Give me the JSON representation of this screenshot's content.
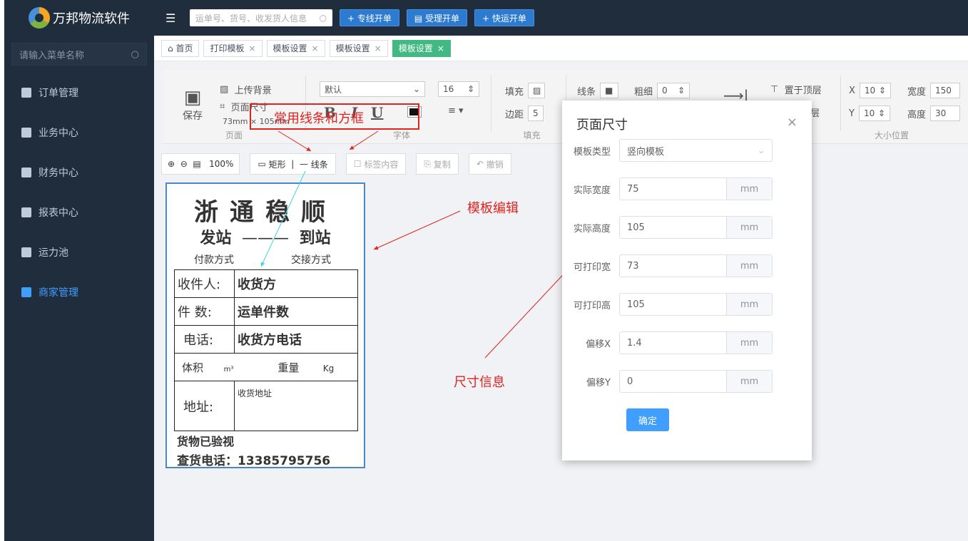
{
  "app": {
    "title": "万邦物流软件"
  },
  "top": {
    "search_placeholder": "运单号、货号、收发货人信息",
    "buttons": [
      "+ 专线开单",
      "▤ 受理开单",
      "+ 快运开单"
    ]
  },
  "sidebar": {
    "search_placeholder": "请输入菜单名称",
    "items": [
      "订单管理",
      "业务中心",
      "财务中心",
      "报表中心",
      "运力池",
      "商家管理"
    ]
  },
  "tabs": [
    {
      "label": "首页"
    },
    {
      "label": "打印模板"
    },
    {
      "label": "模板设置"
    },
    {
      "label": "模板设置"
    },
    {
      "label": "模板设置"
    }
  ],
  "toolbar": {
    "page": {
      "save": "保存",
      "upload": "上传背景",
      "size": "页面尺寸",
      "size_value": "73mm × 105mm",
      "label": "页面"
    },
    "font": {
      "family": "默认",
      "size": "16",
      "bold": "B",
      "italic": "I",
      "underline": "U",
      "label": "字体"
    },
    "fill": {
      "fill": "填充",
      "margin": "边距",
      "margin_value": "5",
      "label": "填充"
    },
    "line": {
      "line": "线条",
      "thick": "粗细",
      "thick_value": "0"
    },
    "layer": {
      "top": "置于顶层",
      "bottom": "层"
    },
    "pos": {
      "x_label": "X",
      "x": "10",
      "y_label": "Y",
      "y": "10",
      "w_label": "宽度",
      "w": "150",
      "h_label": "高度",
      "h": "30",
      "label": "大小位置"
    }
  },
  "tools2": {
    "zoom": "100%",
    "rect": "矩形",
    "line": "线条",
    "label_content": "标签内容",
    "copy": "复制",
    "undo": "撤销"
  },
  "label": {
    "title": "浙通稳顺",
    "from": "发站",
    "to": "到站",
    "pay": "付款方式",
    "handover": "交接方式",
    "rows": [
      {
        "k": "收件人:",
        "v": "收货方"
      },
      {
        "k": "件 数:",
        "v": "运单件数"
      },
      {
        "k": "电话:",
        "v": "收货方电话"
      }
    ],
    "volume": "体积",
    "volume_unit": "m³",
    "weight": "重量",
    "weight_unit": "Kg",
    "address": "地址:",
    "address_value": "收货地址",
    "footer1": "货物已验视",
    "footer2": "查货电话：13385795756"
  },
  "annotations": {
    "lines": "常用线条和方框",
    "edit": "模板编辑",
    "size": "尺寸信息"
  },
  "dialog": {
    "title": "页面尺寸",
    "close": "×",
    "fields": [
      {
        "label": "模板类型",
        "value": "竖向模板",
        "unit": ""
      },
      {
        "label": "实际宽度",
        "value": "75",
        "unit": "mm"
      },
      {
        "label": "实际高度",
        "value": "105",
        "unit": "mm"
      },
      {
        "label": "可打印宽",
        "value": "73",
        "unit": "mm"
      },
      {
        "label": "可打印高",
        "value": "105",
        "unit": "mm"
      },
      {
        "label": "偏移X",
        "value": "1.4",
        "unit": "mm"
      },
      {
        "label": "偏移Y",
        "value": "0",
        "unit": "mm"
      }
    ],
    "ok": "确定"
  },
  "colors": {
    "sidebar": "#1f2d3d",
    "active_tab": "#42b983",
    "primary": "#409eff",
    "annotation": "#e0231f"
  }
}
